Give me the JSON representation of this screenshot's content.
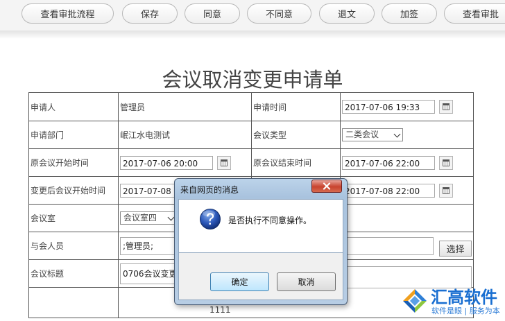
{
  "toolbar": {
    "buttons": [
      "查看审批流程",
      "保存",
      "同意",
      "不同意",
      "退文",
      "加签",
      "查看审批"
    ]
  },
  "form": {
    "title": "会议取消变更申请单",
    "applicant_label": "申请人",
    "applicant_value": "管理员",
    "apply_time_label": "申请时间",
    "apply_time_value": "2017-07-06 19:33",
    "dept_label": "申请部门",
    "dept_value": "岷江水电测试",
    "meeting_type_label": "会议类型",
    "meeting_type_value": "二类会议",
    "orig_start_label": "原会议开始时间",
    "orig_start_value": "2017-07-06 20:00",
    "orig_end_label": "原会议结束时间",
    "orig_end_value": "2017-07-06 22:00",
    "new_start_label": "变更后会议开始时间",
    "new_start_value": "2017-07-08 2",
    "new_end_value": "2017-07-08 22:00",
    "room_label": "会议室",
    "room_value": "会议室四",
    "attendees_label": "与会人员",
    "attendees_value": ";管理员;",
    "select_button": "选择",
    "subject_label": "会议标题",
    "subject_value": "0706会议变更",
    "content_value": "1111"
  },
  "dialog": {
    "title": "来自网页的消息",
    "message": "是否执行不同意操作。",
    "ok_label": "确定",
    "cancel_label": "取消",
    "icon": "question-icon"
  },
  "watermark": {
    "brand": "汇高软件",
    "slogan": "软件是眼 | 服务为本"
  },
  "colors": {
    "dialog_frame": "#a9c3de",
    "close_button": "#c8432e",
    "watermark_blue": "#1a6fd1"
  }
}
